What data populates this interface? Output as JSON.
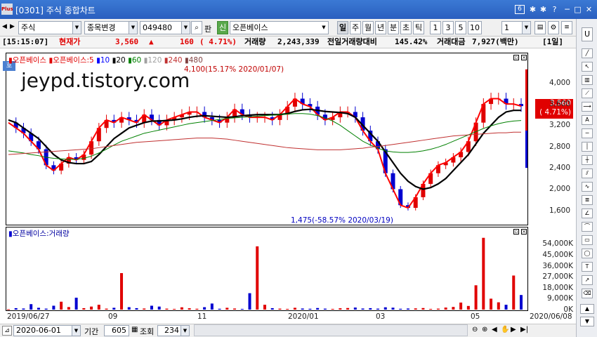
{
  "window": {
    "logo": "Plus",
    "title": "[0301] 주식 종합차트",
    "controls": [
      "6",
      "✱",
      "✱",
      "?",
      "─",
      "□",
      "✕"
    ]
  },
  "toolbar": {
    "market": "주식",
    "stock_change": "종목변경",
    "code": "049480",
    "pan": "판",
    "sin": "신",
    "stock_name": "오픈베이스",
    "periods": [
      "일",
      "주",
      "월",
      "년",
      "분",
      "초",
      "틱"
    ],
    "multipliers": [
      "1",
      "3",
      "5",
      "10"
    ],
    "multiplier_value": "1"
  },
  "info": {
    "time": "[15:15:07]",
    "price_label": "현재가",
    "price": "3,560",
    "change": "160",
    "change_pct": "( 4.71%)",
    "volume_label": "거래량",
    "volume": "2,243,339",
    "prev_ratio_label": "전일거래량대비",
    "prev_ratio": "145.42%",
    "amount_label": "거래대금",
    "amount": "7,927(백만)",
    "period": "[1일]"
  },
  "price_panel": {
    "tag": "호",
    "watermark": "jeypd.tistory.com",
    "legend_name": "오픈베이스",
    "legend_ma_head": "오픈베이스:5",
    "ma_legends": [
      "10",
      "20",
      "60",
      "120",
      "240",
      "480"
    ],
    "high_annot": "4,100(15.17% 2020/01/07)",
    "low_annot": "1,475(-58.57% 2020/03/19)",
    "current_price": "3,560",
    "current_pct": "( 4.71%)",
    "y_ticks": [
      "4,000",
      "3,600",
      "3,200",
      "2,800",
      "2,400",
      "2,000",
      "1,600"
    ]
  },
  "volume_panel": {
    "legend": "오픈베이스:거래량",
    "y_ticks": [
      "54,000K",
      "45,000K",
      "36,000K",
      "27,000K",
      "18,000K",
      "9,000K",
      "0K"
    ]
  },
  "x_axis": {
    "labels": [
      "2019/06/27",
      "09",
      "11",
      "2020/01",
      "03",
      "05",
      "2020/06/08"
    ]
  },
  "bottom": {
    "date": "2020-06-01",
    "period_label": "기간",
    "period_value": "605",
    "query_label": "조회",
    "query_value": "234"
  },
  "colors": {
    "up": "#e00000",
    "down": "#0000d0",
    "ma5": "#ff0000",
    "ma10": "#0000ff",
    "ma20": "#000000",
    "ma60": "#008000",
    "ma120": "#a0a0a0",
    "ma240": "#c03030",
    "ma480": "#804040"
  },
  "chart_data": {
    "type": "candlestick",
    "x_range": [
      "2019/06/27",
      "2020/06/08"
    ],
    "price_ylim": [
      1400,
      4300
    ],
    "volume_ylim": [
      0,
      60000
    ],
    "volume_unit": "K",
    "price_series": [
      {
        "name": "5",
        "values": [
          3250,
          3150,
          3050,
          2900,
          2750,
          2450,
          2350,
          2480,
          2600,
          2550,
          2650,
          2900,
          3150,
          3300,
          3250,
          3350,
          3300,
          3250,
          3400,
          3300,
          3200,
          3300,
          3350,
          3400,
          3450,
          3450,
          3350,
          3300,
          3250,
          3350,
          3500,
          3400,
          3350,
          3350,
          3350,
          3300,
          3400,
          3550,
          3700,
          3600,
          3550,
          3400,
          3300,
          3350,
          3450,
          3450,
          3350,
          3100,
          2900,
          2750,
          2300,
          2000,
          1700,
          1650,
          1850,
          2100,
          2300,
          2450,
          2500,
          2600,
          2700,
          2900,
          3250,
          3600,
          3700,
          3700,
          3600,
          3600,
          3560
        ]
      },
      {
        "name": "20",
        "values": [
          3300,
          3250,
          3150,
          3050,
          2950,
          2800,
          2650,
          2550,
          2500,
          2480,
          2480,
          2520,
          2650,
          2800,
          2950,
          3050,
          3150,
          3200,
          3250,
          3280,
          3280,
          3290,
          3300,
          3320,
          3350,
          3370,
          3380,
          3370,
          3360,
          3350,
          3360,
          3380,
          3390,
          3400,
          3400,
          3400,
          3400,
          3420,
          3460,
          3490,
          3500,
          3480,
          3460,
          3450,
          3440,
          3420,
          3350,
          3200,
          3050,
          2900,
          2700,
          2500,
          2300,
          2150,
          2050,
          2000,
          2030,
          2100,
          2200,
          2350,
          2500,
          2650,
          2850,
          3050,
          3200,
          3350,
          3450,
          3480,
          3480
        ]
      },
      {
        "name": "60",
        "values": [
          2720,
          2700,
          2680,
          2650,
          2630,
          2600,
          2580,
          2570,
          2560,
          2560,
          2580,
          2620,
          2680,
          2750,
          2830,
          2900,
          2950,
          3000,
          3050,
          3080,
          3110,
          3140,
          3170,
          3200,
          3230,
          3250,
          3270,
          3290,
          3310,
          3330,
          3340,
          3350,
          3360,
          3370,
          3380,
          3390,
          3400,
          3410,
          3420,
          3420,
          3410,
          3380,
          3340,
          3280,
          3200,
          3100,
          3000,
          2900,
          2830,
          2770,
          2720,
          2700,
          2690,
          2690,
          2700,
          2720,
          2750,
          2790,
          2840,
          2900,
          2960,
          3020,
          3080,
          3140,
          3190,
          3230,
          3260,
          3280,
          3290
        ]
      },
      {
        "name": "240",
        "values": [
          2650,
          2660,
          2670,
          2680,
          2690,
          2700,
          2710,
          2720,
          2730,
          2740,
          2750,
          2760,
          2780,
          2800,
          2820,
          2840,
          2860,
          2880,
          2890,
          2900,
          2910,
          2920,
          2930,
          2940,
          2950,
          2960,
          2960,
          2960,
          2950,
          2940,
          2920,
          2900,
          2880,
          2860,
          2840,
          2820,
          2800,
          2780,
          2770,
          2760,
          2750,
          2740,
          2740,
          2740,
          2740,
          2750,
          2760,
          2770,
          2790,
          2800,
          2820,
          2840,
          2860,
          2880,
          2900,
          2920,
          2940,
          2960,
          2980,
          3000,
          3010,
          3020,
          3030,
          3040,
          3050,
          3060,
          3060,
          3070,
          3070
        ]
      }
    ],
    "volume_values": [
      300,
      1200,
      900,
      4500,
      1500,
      800,
      3200,
      6500,
      2100,
      9800,
      1200,
      2500,
      4000,
      800,
      1500,
      30000,
      2000,
      1200,
      900,
      3200,
      2500,
      800,
      600,
      1900,
      1100,
      700,
      2000,
      5000,
      700,
      1500,
      900,
      600,
      13500,
      52000,
      4000,
      1200,
      800,
      600,
      1500,
      900,
      700,
      1300,
      800,
      600,
      1100,
      1300,
      1700,
      900,
      1200,
      800,
      1900,
      1600,
      700,
      900,
      1000,
      1300,
      600,
      800,
      1700,
      2200,
      5800,
      3000,
      20000,
      59000,
      9000,
      6000,
      4000,
      28000,
      12000
    ]
  }
}
